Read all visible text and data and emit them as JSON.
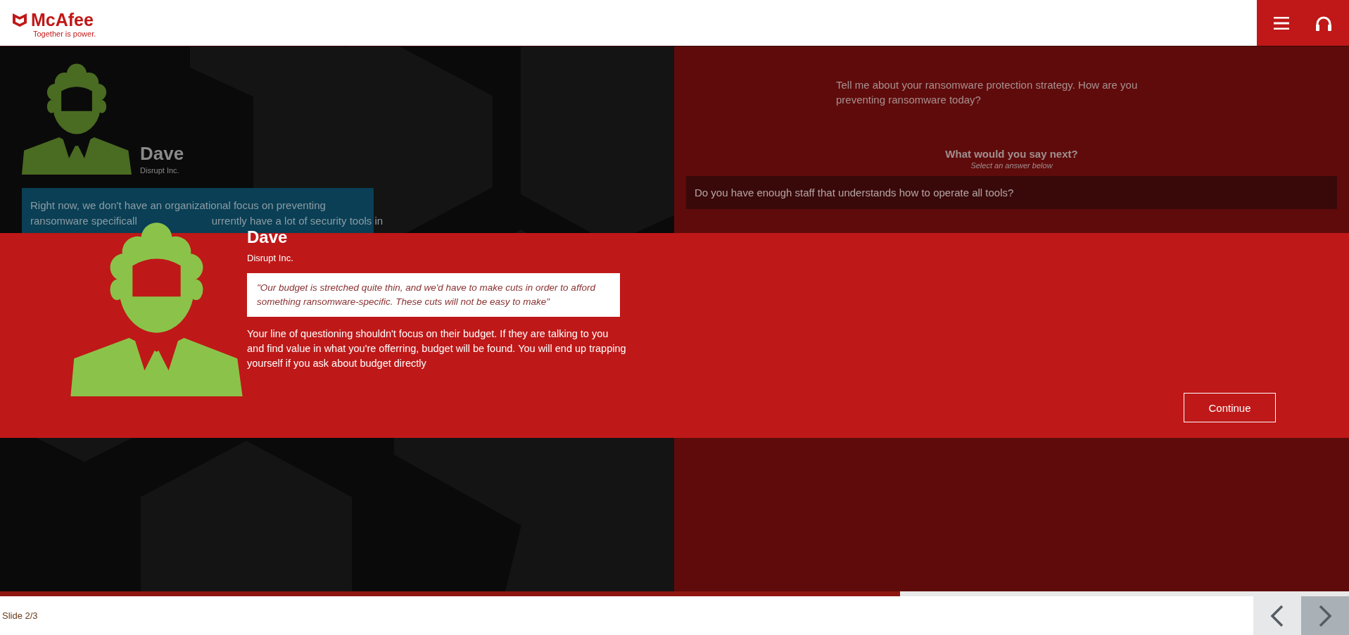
{
  "header": {
    "logo": {
      "name": "McAfee",
      "tagline": "Together is power."
    },
    "buttons": [
      {
        "kind": "menu"
      },
      {
        "kind": "headphones"
      }
    ]
  },
  "conversation": {
    "speaker": {
      "name": "Dave",
      "company": "Disrupt Inc."
    },
    "statement_lines": [
      [
        "Right now, we don't have an organizational focus on preventing"
      ],
      [
        "ransomware specificall",
        "urrently have a lot of security tools in"
      ]
    ]
  },
  "dialogue": {
    "prompt": "Tell me about your ransomware protection strategy. How are you preventing ransomware today?",
    "heading": "What would you say next?",
    "subheading": "Select an answer below",
    "answers": [
      "Do you have enough staff that understands how to operate all tools?"
    ]
  },
  "feedback": {
    "name": "Dave",
    "company": "Disrupt Inc.",
    "quote": "\"Our budget is stretched quite thin, and we'd have to make cuts in order to afford something ransomware-specific. These cuts will not be easy to make\"",
    "explanation": "Your line of questioning shouldn't focus on their budget. If they are talking to you and find value in what you're offerring, budget will be found. You will end up trapping yourself if you ask about budget directly",
    "button": "Continue"
  },
  "progress": {
    "level": 0.667
  },
  "footer": {
    "slide": "Slide 2/3",
    "nav": [
      {
        "kind": "previous"
      },
      {
        "kind": "next"
      }
    ]
  }
}
